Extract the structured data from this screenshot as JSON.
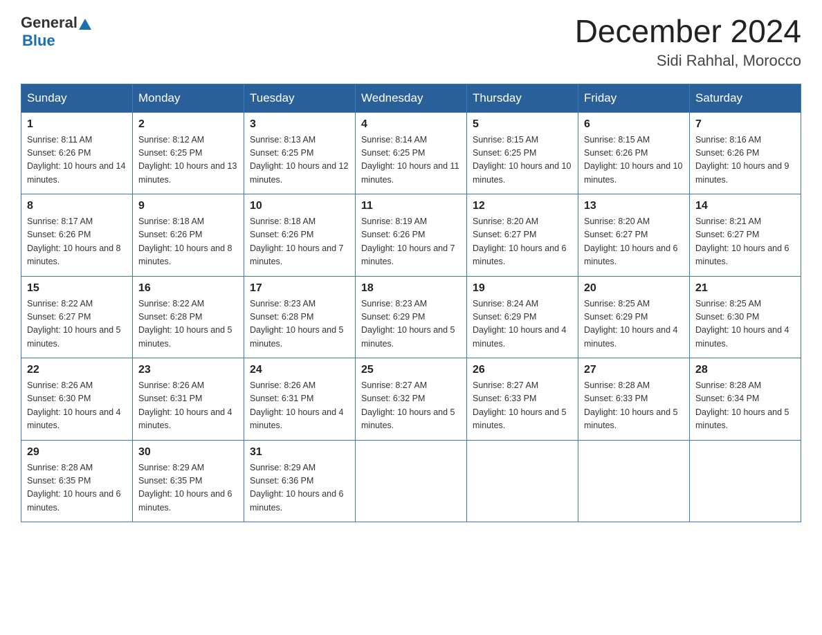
{
  "header": {
    "logo_general": "General",
    "logo_blue": "Blue",
    "month_title": "December 2024",
    "location": "Sidi Rahhal, Morocco"
  },
  "days_of_week": [
    "Sunday",
    "Monday",
    "Tuesday",
    "Wednesday",
    "Thursday",
    "Friday",
    "Saturday"
  ],
  "weeks": [
    [
      {
        "day": "1",
        "sunrise": "8:11 AM",
        "sunset": "6:26 PM",
        "daylight": "10 hours and 14 minutes."
      },
      {
        "day": "2",
        "sunrise": "8:12 AM",
        "sunset": "6:25 PM",
        "daylight": "10 hours and 13 minutes."
      },
      {
        "day": "3",
        "sunrise": "8:13 AM",
        "sunset": "6:25 PM",
        "daylight": "10 hours and 12 minutes."
      },
      {
        "day": "4",
        "sunrise": "8:14 AM",
        "sunset": "6:25 PM",
        "daylight": "10 hours and 11 minutes."
      },
      {
        "day": "5",
        "sunrise": "8:15 AM",
        "sunset": "6:25 PM",
        "daylight": "10 hours and 10 minutes."
      },
      {
        "day": "6",
        "sunrise": "8:15 AM",
        "sunset": "6:26 PM",
        "daylight": "10 hours and 10 minutes."
      },
      {
        "day": "7",
        "sunrise": "8:16 AM",
        "sunset": "6:26 PM",
        "daylight": "10 hours and 9 minutes."
      }
    ],
    [
      {
        "day": "8",
        "sunrise": "8:17 AM",
        "sunset": "6:26 PM",
        "daylight": "10 hours and 8 minutes."
      },
      {
        "day": "9",
        "sunrise": "8:18 AM",
        "sunset": "6:26 PM",
        "daylight": "10 hours and 8 minutes."
      },
      {
        "day": "10",
        "sunrise": "8:18 AM",
        "sunset": "6:26 PM",
        "daylight": "10 hours and 7 minutes."
      },
      {
        "day": "11",
        "sunrise": "8:19 AM",
        "sunset": "6:26 PM",
        "daylight": "10 hours and 7 minutes."
      },
      {
        "day": "12",
        "sunrise": "8:20 AM",
        "sunset": "6:27 PM",
        "daylight": "10 hours and 6 minutes."
      },
      {
        "day": "13",
        "sunrise": "8:20 AM",
        "sunset": "6:27 PM",
        "daylight": "10 hours and 6 minutes."
      },
      {
        "day": "14",
        "sunrise": "8:21 AM",
        "sunset": "6:27 PM",
        "daylight": "10 hours and 6 minutes."
      }
    ],
    [
      {
        "day": "15",
        "sunrise": "8:22 AM",
        "sunset": "6:27 PM",
        "daylight": "10 hours and 5 minutes."
      },
      {
        "day": "16",
        "sunrise": "8:22 AM",
        "sunset": "6:28 PM",
        "daylight": "10 hours and 5 minutes."
      },
      {
        "day": "17",
        "sunrise": "8:23 AM",
        "sunset": "6:28 PM",
        "daylight": "10 hours and 5 minutes."
      },
      {
        "day": "18",
        "sunrise": "8:23 AM",
        "sunset": "6:29 PM",
        "daylight": "10 hours and 5 minutes."
      },
      {
        "day": "19",
        "sunrise": "8:24 AM",
        "sunset": "6:29 PM",
        "daylight": "10 hours and 4 minutes."
      },
      {
        "day": "20",
        "sunrise": "8:25 AM",
        "sunset": "6:29 PM",
        "daylight": "10 hours and 4 minutes."
      },
      {
        "day": "21",
        "sunrise": "8:25 AM",
        "sunset": "6:30 PM",
        "daylight": "10 hours and 4 minutes."
      }
    ],
    [
      {
        "day": "22",
        "sunrise": "8:26 AM",
        "sunset": "6:30 PM",
        "daylight": "10 hours and 4 minutes."
      },
      {
        "day": "23",
        "sunrise": "8:26 AM",
        "sunset": "6:31 PM",
        "daylight": "10 hours and 4 minutes."
      },
      {
        "day": "24",
        "sunrise": "8:26 AM",
        "sunset": "6:31 PM",
        "daylight": "10 hours and 4 minutes."
      },
      {
        "day": "25",
        "sunrise": "8:27 AM",
        "sunset": "6:32 PM",
        "daylight": "10 hours and 5 minutes."
      },
      {
        "day": "26",
        "sunrise": "8:27 AM",
        "sunset": "6:33 PM",
        "daylight": "10 hours and 5 minutes."
      },
      {
        "day": "27",
        "sunrise": "8:28 AM",
        "sunset": "6:33 PM",
        "daylight": "10 hours and 5 minutes."
      },
      {
        "day": "28",
        "sunrise": "8:28 AM",
        "sunset": "6:34 PM",
        "daylight": "10 hours and 5 minutes."
      }
    ],
    [
      {
        "day": "29",
        "sunrise": "8:28 AM",
        "sunset": "6:35 PM",
        "daylight": "10 hours and 6 minutes."
      },
      {
        "day": "30",
        "sunrise": "8:29 AM",
        "sunset": "6:35 PM",
        "daylight": "10 hours and 6 minutes."
      },
      {
        "day": "31",
        "sunrise": "8:29 AM",
        "sunset": "6:36 PM",
        "daylight": "10 hours and 6 minutes."
      },
      null,
      null,
      null,
      null
    ]
  ],
  "labels": {
    "sunrise_prefix": "Sunrise: ",
    "sunset_prefix": "Sunset: ",
    "daylight_prefix": "Daylight: "
  }
}
